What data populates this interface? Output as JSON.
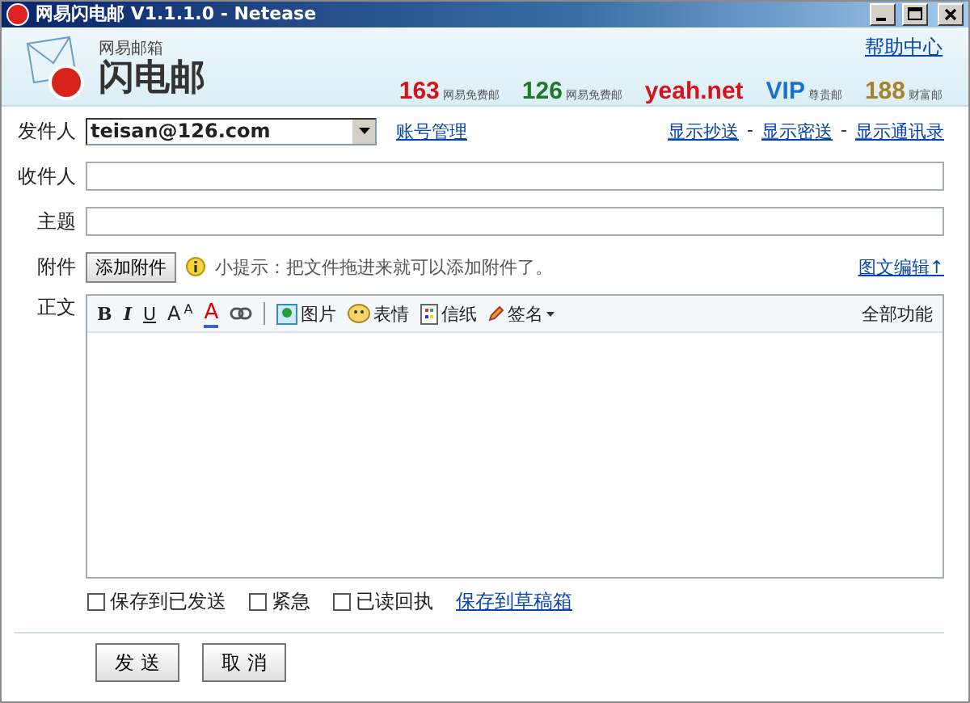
{
  "window": {
    "title": "网易闪电邮 V1.1.1.0 - Netease"
  },
  "header": {
    "product_small": "网易邮箱",
    "product_name": "闪电邮",
    "help_link": "帮助中心",
    "brands": [
      {
        "name": "163",
        "tagline": "网易免费邮",
        "color": "#d4141a"
      },
      {
        "name": "126",
        "tagline": "网易免费邮",
        "color": "#1a7a2a"
      },
      {
        "name": "yeah.net",
        "color": "#d4141a"
      },
      {
        "name": "VIP",
        "tagline": "尊贵邮",
        "color": "#1a6fd0"
      },
      {
        "name": "188",
        "tagline": "财富邮",
        "color": "#a8822a"
      }
    ]
  },
  "sender": {
    "label": "发件人",
    "value": "teisan@126.com",
    "account_link": "账号管理",
    "links": [
      "显示抄送",
      "显示密送",
      "显示通讯录"
    ],
    "separator": "-"
  },
  "recipient": {
    "label": "收件人"
  },
  "subject": {
    "label": "主题"
  },
  "attachment": {
    "label": "附件",
    "button": "添加附件",
    "tip": "小提示：把文件拖进来就可以添加附件了。",
    "mode_link": "图文编辑↑"
  },
  "body": {
    "label": "正文",
    "all_features": "全部功能",
    "toolbar": [
      {
        "kind": "bold",
        "label": "B"
      },
      {
        "kind": "italic",
        "label": "I"
      },
      {
        "kind": "underline",
        "label": "U"
      },
      {
        "kind": "font-size",
        "label": "A",
        "superscript": "A"
      },
      {
        "kind": "font-color",
        "label": "A"
      },
      {
        "kind": "link"
      },
      {
        "kind": "separator"
      },
      {
        "kind": "picture",
        "label": "图片"
      },
      {
        "kind": "emoticon",
        "label": "表情"
      },
      {
        "kind": "stationery",
        "label": "信纸"
      },
      {
        "kind": "signature",
        "label": "签名"
      }
    ]
  },
  "options": [
    {
      "label": "保存到已发送",
      "checked": false
    },
    {
      "label": "紧急",
      "checked": false
    },
    {
      "label": "已读回执",
      "checked": false
    }
  ],
  "draft_link": "保存到草稿箱",
  "buttons": [
    "发 送",
    "取 消"
  ]
}
